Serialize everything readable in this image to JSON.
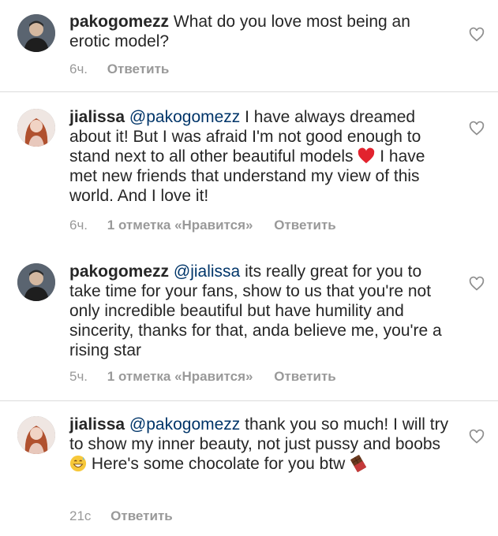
{
  "comments": [
    {
      "username": "pakogomezz",
      "mention": "",
      "text": "What do you love most being an erotic model?",
      "time": "6ч.",
      "likes": "",
      "reply": "Ответить",
      "avatar": "avatar-pakogomezz"
    },
    {
      "username": "jialissa",
      "mention": "@pakogomezz",
      "text_before_emoji": "I have always dreamed about it! But I was afraid I'm not good enough to stand next to all other beautiful models",
      "text_after_emoji": "I have met new friends that understand my view of this world. And I love it!",
      "emoji": "red-heart-emoji",
      "time": "6ч.",
      "likes": "1 отметка «Нравится»",
      "reply": "Ответить",
      "avatar": "avatar-jialissa"
    },
    {
      "username": "pakogomezz",
      "mention": "@jialissa",
      "text": "its really great for you to take time for your fans, show to us that you're not only incredible beautiful but have humility and  sincerity, thanks for that, anda believe me, you're a rising star",
      "time": "5ч.",
      "likes": "1 отметка «Нравится»",
      "reply": "Ответить",
      "avatar": "avatar-pakogomezz"
    },
    {
      "username": "jialissa",
      "mention": "@pakogomezz",
      "text_before_emoji": "thank you so much! I will try to show my inner beauty, not just pussy and boobs",
      "text_after_emoji": "Here's some chocolate for you btw",
      "emoji": "grinning-sweat-emoji",
      "emoji2": "chocolate-bar-emoji",
      "time": "21с",
      "likes": "",
      "reply": "Ответить",
      "avatar": "avatar-jialissa"
    }
  ],
  "colors": {
    "text": "#262626",
    "meta": "#999999",
    "divider": "#dbdbdb",
    "heart_outline": "#8e8e8e"
  },
  "icons": [
    "heart-outline-icon",
    "red-heart-emoji",
    "grinning-sweat-emoji",
    "chocolate-bar-emoji"
  ]
}
